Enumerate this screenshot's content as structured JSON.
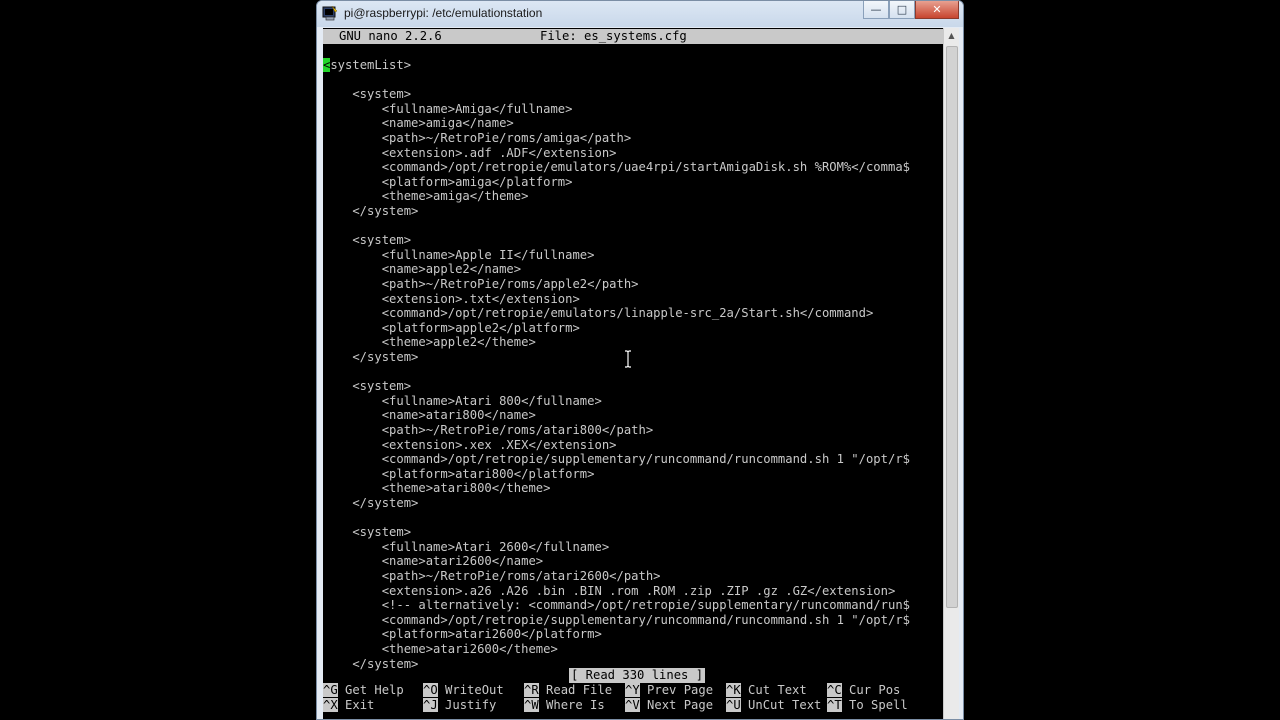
{
  "window": {
    "title": "pi@raspberrypi: /etc/emulationstation",
    "minimize_glyph": "—",
    "maximize_glyph": "□",
    "close_glyph": "✕"
  },
  "nano": {
    "version": "GNU nano 2.2.6",
    "file": "File: es_systems.cfg",
    "status": "[ Read 330 lines ]"
  },
  "editor": {
    "cursor_char": "<",
    "first_line_rest": "systemList>",
    "lines": [
      "",
      "    <system>",
      "        <fullname>Amiga</fullname>",
      "        <name>amiga</name>",
      "        <path>~/RetroPie/roms/amiga</path>",
      "        <extension>.adf .ADF</extension>",
      "        <command>/opt/retropie/emulators/uae4rpi/startAmigaDisk.sh %ROM%</comma$",
      "        <platform>amiga</platform>",
      "        <theme>amiga</theme>",
      "    </system>",
      "",
      "    <system>",
      "        <fullname>Apple II</fullname>",
      "        <name>apple2</name>",
      "        <path>~/RetroPie/roms/apple2</path>",
      "        <extension>.txt</extension>",
      "        <command>/opt/retropie/emulators/linapple-src_2a/Start.sh</command>",
      "        <platform>apple2</platform>",
      "        <theme>apple2</theme>",
      "    </system>",
      "",
      "    <system>",
      "        <fullname>Atari 800</fullname>",
      "        <name>atari800</name>",
      "        <path>~/RetroPie/roms/atari800</path>",
      "        <extension>.xex .XEX</extension>",
      "        <command>/opt/retropie/supplementary/runcommand/runcommand.sh 1 \"/opt/r$",
      "        <platform>atari800</platform>",
      "        <theme>atari800</theme>",
      "    </system>",
      "",
      "    <system>",
      "        <fullname>Atari 2600</fullname>",
      "        <name>atari2600</name>",
      "        <path>~/RetroPie/roms/atari2600</path>",
      "        <extension>.a26 .A26 .bin .BIN .rom .ROM .zip .ZIP .gz .GZ</extension>",
      "        <!-- alternatively: <command>/opt/retropie/supplementary/runcommand/run$",
      "        <command>/opt/retropie/supplementary/runcommand/runcommand.sh 1 \"/opt/r$",
      "        <platform>atari2600</platform>",
      "        <theme>atari2600</theme>",
      "    </system>"
    ]
  },
  "shortcuts": [
    [
      {
        "key": "^G",
        "label": " Get Help"
      },
      {
        "key": "^O",
        "label": " WriteOut"
      },
      {
        "key": "^R",
        "label": " Read File"
      },
      {
        "key": "^Y",
        "label": " Prev Page"
      },
      {
        "key": "^K",
        "label": " Cut Text"
      },
      {
        "key": "^C",
        "label": " Cur Pos"
      }
    ],
    [
      {
        "key": "^X",
        "label": " Exit"
      },
      {
        "key": "^J",
        "label": " Justify"
      },
      {
        "key": "^W",
        "label": " Where Is"
      },
      {
        "key": "^V",
        "label": " Next Page"
      },
      {
        "key": "^U",
        "label": " UnCut Text"
      },
      {
        "key": "^T",
        "label": " To Spell"
      }
    ]
  ],
  "icons": {
    "app": "putty-terminal-icon",
    "mouse": "text-ibeam-cursor"
  }
}
